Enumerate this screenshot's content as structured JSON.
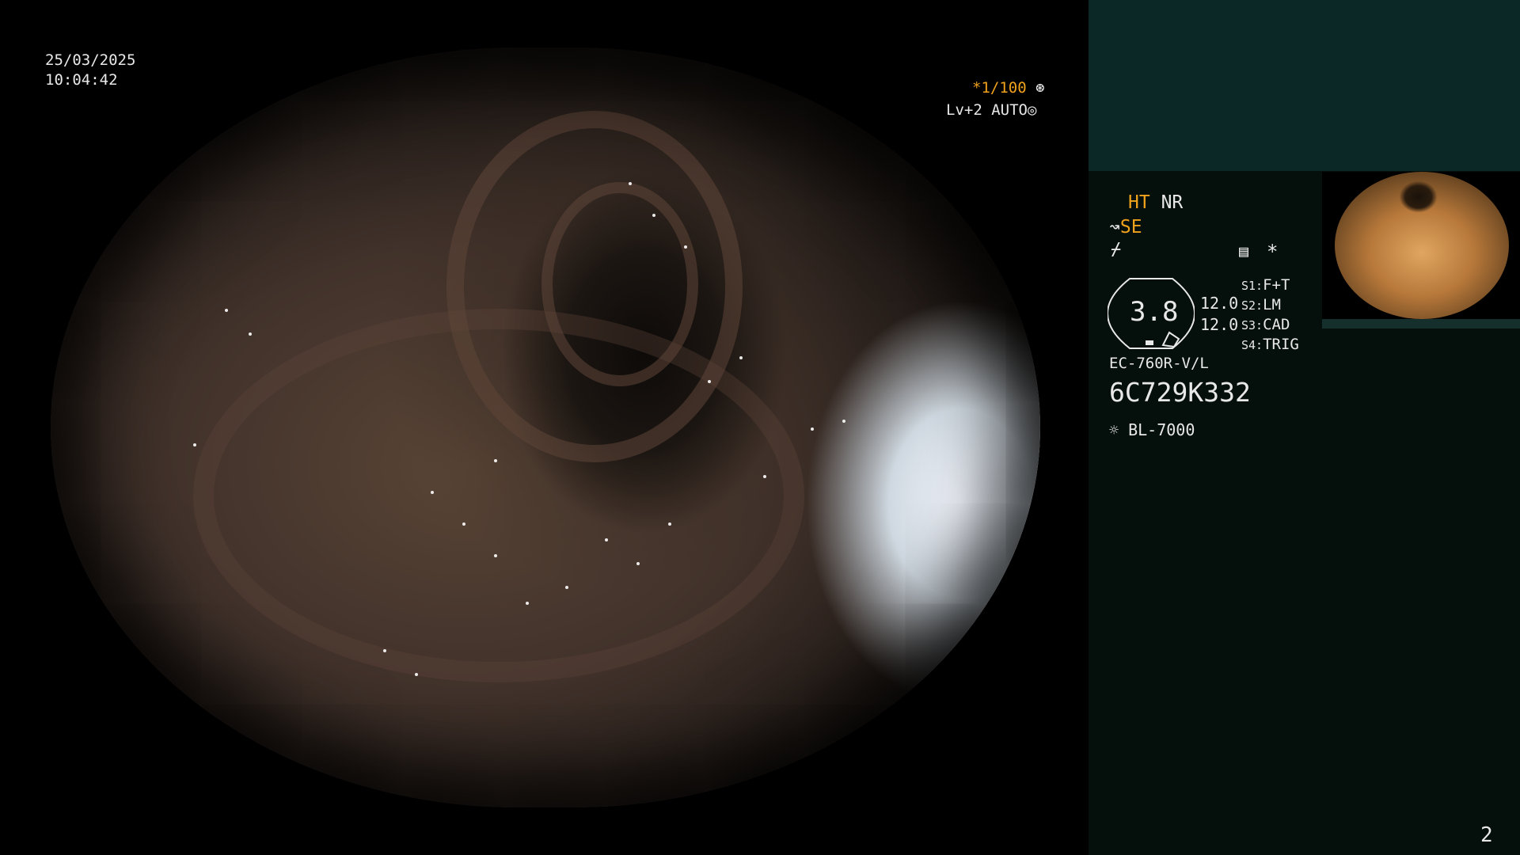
{
  "osd": {
    "date": "25/03/2025",
    "time": "10:04:42",
    "shutter": "*1/100",
    "level": "Lv+2",
    "auto": "AUTO"
  },
  "side": {
    "ht": "HT",
    "nr": "NR",
    "se": "SE",
    "zoom": "3.8",
    "val1": "12.0",
    "val2": "12.0",
    "s1_label": "S1:",
    "s1_value": "F+T",
    "s2_label": "S2:",
    "s2_value": "LM",
    "s3_label": "S3:",
    "s3_value": "CAD",
    "s4_label": "S4:",
    "s4_value": "TRIG",
    "asterisk": "*",
    "scope_model": "EC-760R-V/L",
    "serial": "6C729K332",
    "light_source": "BL-7000",
    "page_number": "2"
  },
  "colors": {
    "accent_orange": "#f0a21c",
    "panel_top": "#0c2826",
    "panel_body": "#05100d"
  },
  "icons": [
    "shutter-icon",
    "auto-icon",
    "se-icon",
    "mode-icon",
    "menu-icon",
    "light-icon"
  ]
}
